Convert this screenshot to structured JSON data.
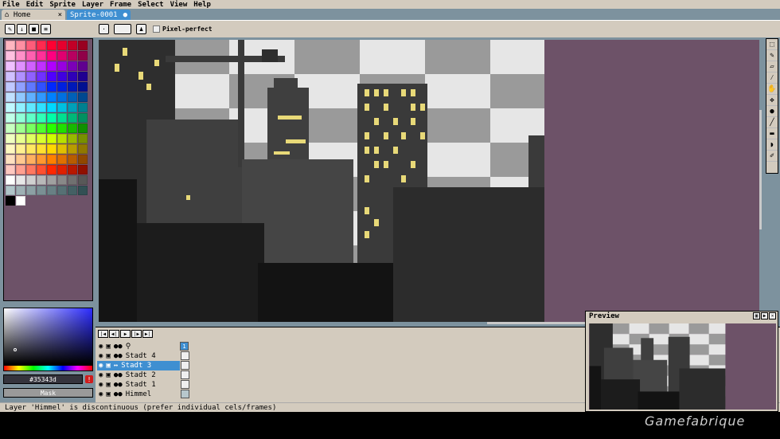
{
  "menu": {
    "items": [
      "File",
      "Edit",
      "Sprite",
      "Layer",
      "Frame",
      "Select",
      "View",
      "Help"
    ]
  },
  "tabs": [
    {
      "label": "Home",
      "close": "×"
    },
    {
      "label": "Sprite-0001",
      "close": "●"
    }
  ],
  "toolbar": {
    "pixel_perfect": "Pixel-perfect"
  },
  "palette": {
    "count_label": "#"
  },
  "color": {
    "hex": "#35343d",
    "mask_label": "Mask",
    "warn": "!"
  },
  "timeline": {
    "layers": [
      {
        "name": "Stadt 4"
      },
      {
        "name": "Stadt 3"
      },
      {
        "name": "Stadt 2"
      },
      {
        "name": "Stadt 1"
      },
      {
        "name": "Himmel"
      }
    ],
    "frame_number": "1"
  },
  "status": {
    "text": "Layer 'Himmel' is discontinuous (prefer individual cels/frames)"
  },
  "preview": {
    "title": "Preview"
  },
  "watermark": "Gamefabrique",
  "colors": {
    "accent": "#3f8fd1",
    "panel": "#d3cbbe",
    "bg": "#7d929e",
    "canvas_bg": "#6d5268"
  }
}
